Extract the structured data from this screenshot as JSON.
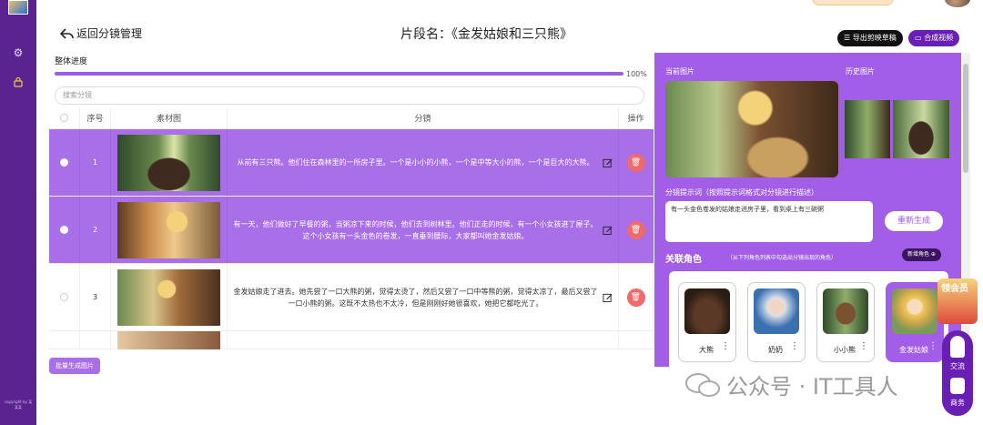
{
  "rail": {
    "footer": "copyright by 某某某"
  },
  "header": {
    "back_label": "返回分镜管理",
    "title": "片段名：《金发姑娘和三只熊》",
    "export_label": "导出剪映草稿",
    "compose_label": "合成视频"
  },
  "progress": {
    "label": "整体进度",
    "value": 100,
    "percent_text": "100%"
  },
  "search": {
    "placeholder": "搜索分镜"
  },
  "table": {
    "columns": [
      "",
      "序号",
      "素材图",
      "分镜",
      "操作"
    ],
    "rows": [
      {
        "index": "1",
        "selected": true,
        "text": "从前有三只熊。他们住在森林里的一所房子里。一个是小小的小熊，一个是中等大小的熊，一个是巨大的大熊。"
      },
      {
        "index": "2",
        "selected": true,
        "text": "有一天，他们做好了早餐的粥，当粥凉下来的时候，他们去到树林里。他们正走的时候，有一个小女孩进了屋子。这个小女孩有一头金色的卷发，一直垂到腰际，大家都叫她金发姑娘。"
      },
      {
        "index": "3",
        "selected": false,
        "text": "金发姑娘走了进去。她先尝了一口大熊的粥，觉得太烫了，然后又尝了一口中等熊的粥，觉得太凉了，最后又尝了一口小熊的粥。这既不太热也不太冷，但是刚刚好她很喜欢，她把它都吃光了。"
      }
    ]
  },
  "batch_button": "批量生成图片",
  "panel": {
    "current_label": "当前图片",
    "history_label": "历史图片",
    "prompt_label": "分镜提示词（按照提示词格式对分镜进行描述）",
    "prompt_value": "有一头金色卷发的姑娘走进房子里，看到桌上有三碗粥",
    "regen_label": "重新生成",
    "roles_title": "关联角色",
    "roles_hint": "（从下列角色列表中勾选出分镜出现的角色）",
    "new_role_label": "新增角色 ⊕",
    "roles": [
      {
        "name": "大熊",
        "selected": false
      },
      {
        "name": "奶奶",
        "selected": false
      },
      {
        "name": "小小熊",
        "selected": false
      },
      {
        "name": "金发姑娘",
        "selected": true
      }
    ]
  },
  "floating": {
    "gift_text": "领会员",
    "chat_label": "交流",
    "biz_label": "商务"
  },
  "watermark": "公众号 · IT工具人",
  "colors": {
    "brand": "#6a1fb4",
    "accent": "#a35ee8",
    "selected_row": "#a86fe8",
    "delete": "#ef6a6a",
    "rail": "#5b2390"
  }
}
